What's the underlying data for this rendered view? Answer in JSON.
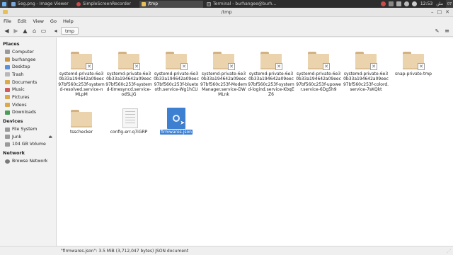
{
  "taskbar": {
    "tasks": [
      {
        "label": "5eg.png - Image Viewer",
        "active": false
      },
      {
        "label": "SimpleScreenRecorder",
        "active": false
      },
      {
        "label": "/tmp",
        "active": true
      },
      {
        "label": "Terminal - burhangee@burh...",
        "active": false
      }
    ],
    "clock": "12:53",
    "lang": "ملن",
    "corner": "07"
  },
  "window": {
    "title": "/tmp",
    "minimize": "–",
    "maximize": "□",
    "close": "✕"
  },
  "menubar": [
    "File",
    "Edit",
    "View",
    "Go",
    "Help"
  ],
  "toolbar": {
    "path_button": "tmp"
  },
  "sidebar": {
    "places_header": "Places",
    "places": [
      {
        "label": "Computer",
        "icon": "computer-icon"
      },
      {
        "label": "burhangee",
        "icon": "home-icon"
      },
      {
        "label": "Desktop",
        "icon": "desktop-icon"
      },
      {
        "label": "Trash",
        "icon": "trash-icon"
      },
      {
        "label": "Documents",
        "icon": "documents-icon"
      },
      {
        "label": "Music",
        "icon": "music-icon"
      },
      {
        "label": "Pictures",
        "icon": "pictures-icon"
      },
      {
        "label": "Videos",
        "icon": "videos-icon"
      },
      {
        "label": "Downloads",
        "icon": "downloads-icon"
      }
    ],
    "devices_header": "Devices",
    "devices": [
      {
        "label": "File System",
        "icon": "drive-icon"
      },
      {
        "label": "Junk",
        "icon": "drive-icon"
      },
      {
        "label": "104 GB Volume",
        "icon": "drive-icon"
      }
    ],
    "network_header": "Network",
    "network": [
      {
        "label": "Browse Network",
        "icon": "network-icon"
      }
    ]
  },
  "files": [
    {
      "label": "systemd-private-6e30b33a194642a09eec97bf560c253f-systemd-resolved.service-nMLpM",
      "type": "locked-folder"
    },
    {
      "label": "systemd-private-6e30b33a194642a09eec97bf560c253f-systemd-timesyncd.service-odSLjG",
      "type": "locked-folder"
    },
    {
      "label": "systemd-private-6e30b33a194642a09eec97bf560c253f-bluetooth.service-Wg1hCU",
      "type": "locked-folder"
    },
    {
      "label": "systemd-private-6e30b33a194642a09eec97bf560c253f-ModemManager.service-DWMLnk",
      "type": "locked-folder"
    },
    {
      "label": "systemd-private-6e30b33a194642a09eec97bf560c253f-systemd-logind.service-KbqEZ6",
      "type": "locked-folder"
    },
    {
      "label": "systemd-private-6e30b33a194642a09eec97bf560c253f-upower.service-6Dg5h9",
      "type": "locked-folder"
    },
    {
      "label": "systemd-private-6e30b33a194642a09eec97bf560c253f-colord.service-7sKQkt",
      "type": "locked-folder"
    },
    {
      "label": "snap-private-tmp",
      "type": "locked-folder"
    },
    {
      "label": "tsschecker",
      "type": "folder"
    },
    {
      "label": "config-err-q7iGRP",
      "type": "text-file"
    },
    {
      "label": "firmwares.json",
      "type": "json-file",
      "selected": true
    }
  ],
  "status": "\"firmwares.json\": 3.5 MiB (3,712,047 bytes) JSON document",
  "colors": {
    "selection": "#3d7fd1",
    "folder": "#ead3ad",
    "taskbar": "#2d2d2d"
  }
}
